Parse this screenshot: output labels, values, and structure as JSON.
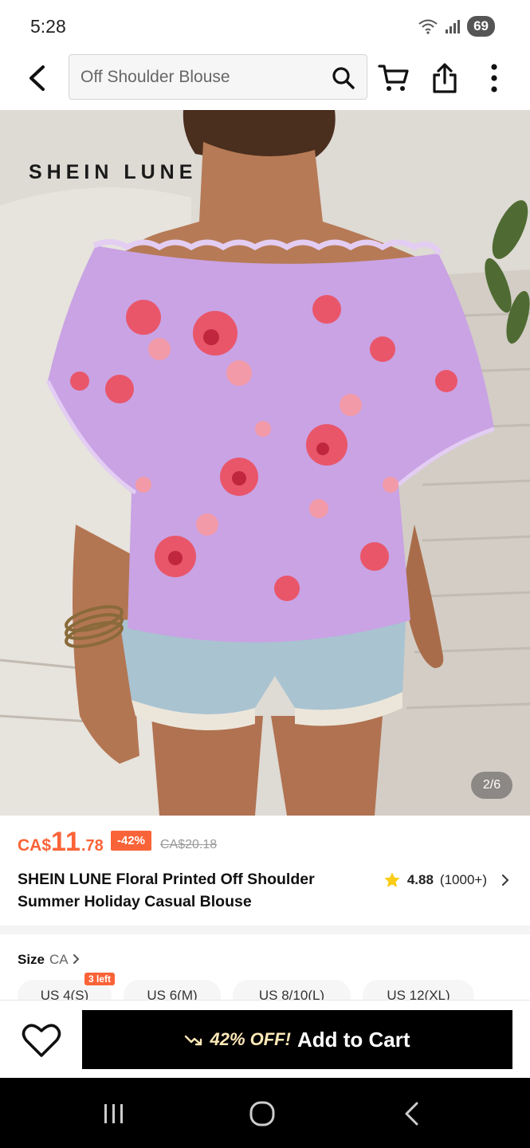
{
  "status": {
    "time": "5:28",
    "battery": "69"
  },
  "search": {
    "value": "Off Shoulder Blouse"
  },
  "hero": {
    "brand": "SHEIN LUNE",
    "counter": "2/6"
  },
  "product": {
    "currency": "CA$",
    "price_int": "11",
    "price_dec": ".78",
    "discount": "-42%",
    "original_price": "CA$20.18",
    "title": "SHEIN LUNE Floral Printed Off Shoulder Summer Holiday Casual Blouse",
    "rating": "4.88",
    "review_count": "(1000+)"
  },
  "size": {
    "label": "Size",
    "region": "CA",
    "stock_badge": "3 left",
    "options": [
      "US 4(S)",
      "US 6(M)",
      "US 8/10(L)",
      "US 12(XL)"
    ]
  },
  "bottom": {
    "promo": "42% OFF!",
    "cta": "Add to Cart"
  },
  "colors": {
    "accent": "#fa6338",
    "cta_bg": "#000000",
    "star": "#facc15"
  }
}
